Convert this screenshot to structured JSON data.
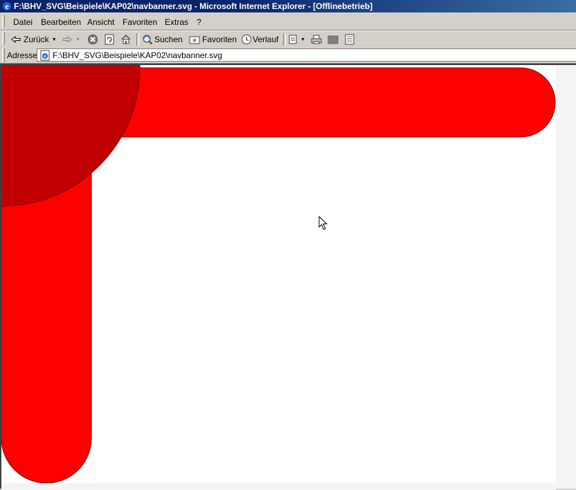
{
  "window": {
    "title": "F:\\BHV_SVG\\Beispiele\\KAP02\\navbanner.svg - Microsoft Internet Explorer - [Offlinebetrieb]"
  },
  "menu": {
    "items": [
      "Datei",
      "Bearbeiten",
      "Ansicht",
      "Favoriten",
      "Extras",
      "?"
    ]
  },
  "toolbar": {
    "back_label": "Zurück",
    "search_label": "Suchen",
    "favorites_label": "Favoriten",
    "history_label": "Verlauf"
  },
  "address": {
    "label": "Adresse",
    "url": "F:\\BHV_SVG\\Beispiele\\KAP02\\navbanner.svg"
  },
  "document": {
    "bar_color": "#ff0000",
    "circle_color": "#c00000",
    "outline_color": "#800000",
    "background": "#ffffff"
  },
  "icons": [
    "ie-logo-icon",
    "back-arrow-icon",
    "forward-arrow-icon",
    "stop-icon",
    "refresh-icon",
    "home-icon",
    "search-icon",
    "favorites-icon",
    "history-icon",
    "mail-icon",
    "print-icon",
    "edit-icon",
    "discuss-icon",
    "page-icon",
    "mouse-cursor-icon"
  ]
}
